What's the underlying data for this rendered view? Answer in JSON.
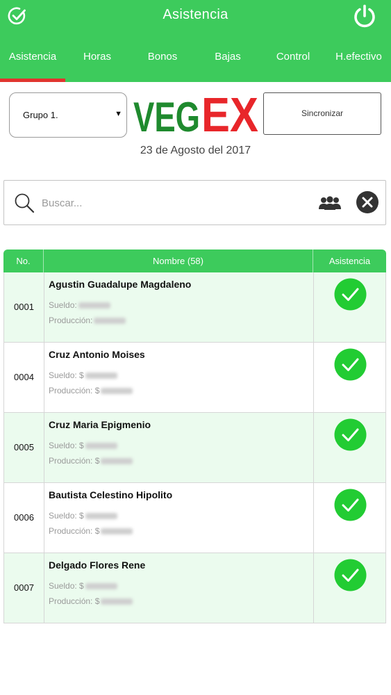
{
  "appbar": {
    "title": "Asistencia",
    "left_icon": "check-circle-icon",
    "right_icon": "power-icon"
  },
  "tabs": [
    {
      "label": "Asistencia",
      "active": true
    },
    {
      "label": "Horas"
    },
    {
      "label": "Bonos"
    },
    {
      "label": "Bajas"
    },
    {
      "label": "Control"
    },
    {
      "label": "H.efectivo"
    }
  ],
  "filters": {
    "group": "Grupo 1.",
    "sync_label": "Sincronizar"
  },
  "logo": {
    "part1": "VEG",
    "part2": "EX"
  },
  "date": "23 de Agosto del 2017",
  "search": {
    "placeholder": "Buscar..."
  },
  "table": {
    "headers": {
      "no": "No.",
      "name": "Nombre (58)",
      "attendance": "Asistencia"
    },
    "rows": [
      {
        "no": "0001",
        "name": "Agustin Guadalupe Magdaleno",
        "salary_label": "Sueldo:",
        "production_label": "Producción:",
        "present": true
      },
      {
        "no": "0004",
        "name": "Cruz Antonio Moises",
        "salary_label": "Sueldo: $",
        "production_label": "Producción: $",
        "present": true
      },
      {
        "no": "0005",
        "name": "Cruz Maria Epigmenio",
        "salary_label": "Sueldo: $",
        "production_label": "Producción: $",
        "present": true
      },
      {
        "no": "0006",
        "name": "Bautista Celestino Hipolito",
        "salary_label": "Sueldo: $",
        "production_label": "Producción: $",
        "present": true
      },
      {
        "no": "0007",
        "name": "Delgado Flores Rene",
        "salary_label": "Sueldo: $",
        "production_label": "Producción: $",
        "present": true
      }
    ]
  },
  "colors": {
    "primary": "#3dcb5c",
    "indicator": "#e2342f",
    "row_alt": "#ebfbee",
    "check": "#22cc33",
    "logo_green": "#1f8a2e",
    "logo_red": "#e8262a"
  }
}
